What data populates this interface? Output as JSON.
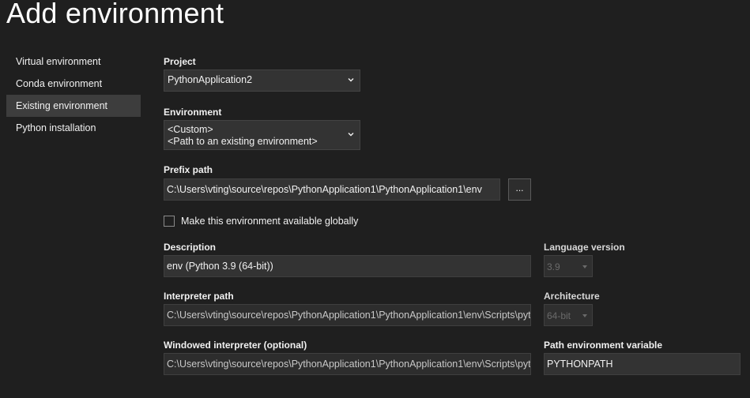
{
  "page": {
    "title": "Add environment"
  },
  "sidebar": {
    "items": [
      {
        "label": "Virtual environment"
      },
      {
        "label": "Conda environment"
      },
      {
        "label": "Existing environment"
      },
      {
        "label": "Python installation"
      }
    ],
    "selected": "Existing environment"
  },
  "project": {
    "label": "Project",
    "value": "PythonApplication2"
  },
  "environment": {
    "label": "Environment",
    "value_line1": "<Custom>",
    "value_line2": "<Path to an existing environment>"
  },
  "prefix": {
    "label": "Prefix path",
    "value": "C:\\Users\\vting\\source\\repos\\PythonApplication1\\PythonApplication1\\env",
    "browse_label": "..."
  },
  "global_checkbox": {
    "label": "Make this environment available globally",
    "checked": false
  },
  "description": {
    "label": "Description",
    "value": "env (Python 3.9 (64-bit))"
  },
  "language_version": {
    "label": "Language version",
    "value": "3.9"
  },
  "interpreter": {
    "label": "Interpreter path",
    "value": "C:\\Users\\vting\\source\\repos\\PythonApplication1\\PythonApplication1\\env\\Scripts\\python.exe"
  },
  "architecture": {
    "label": "Architecture",
    "value": "64-bit"
  },
  "windowed": {
    "label": "Windowed interpreter (optional)",
    "value": "C:\\Users\\vting\\source\\repos\\PythonApplication1\\PythonApplication1\\env\\Scripts\\pythonw.exe"
  },
  "path_env": {
    "label": "Path environment variable",
    "value": "PYTHONPATH"
  },
  "colors": {
    "background": "#1f1f1f",
    "field": "#333333",
    "selected_item": "#3d3d3d",
    "text": "#f1f1f1",
    "disabled_text": "#6a6a6a"
  },
  "icons": {
    "dropdown": "chevron-down-icon",
    "disabled_dropdown": "triangle-down-icon"
  }
}
